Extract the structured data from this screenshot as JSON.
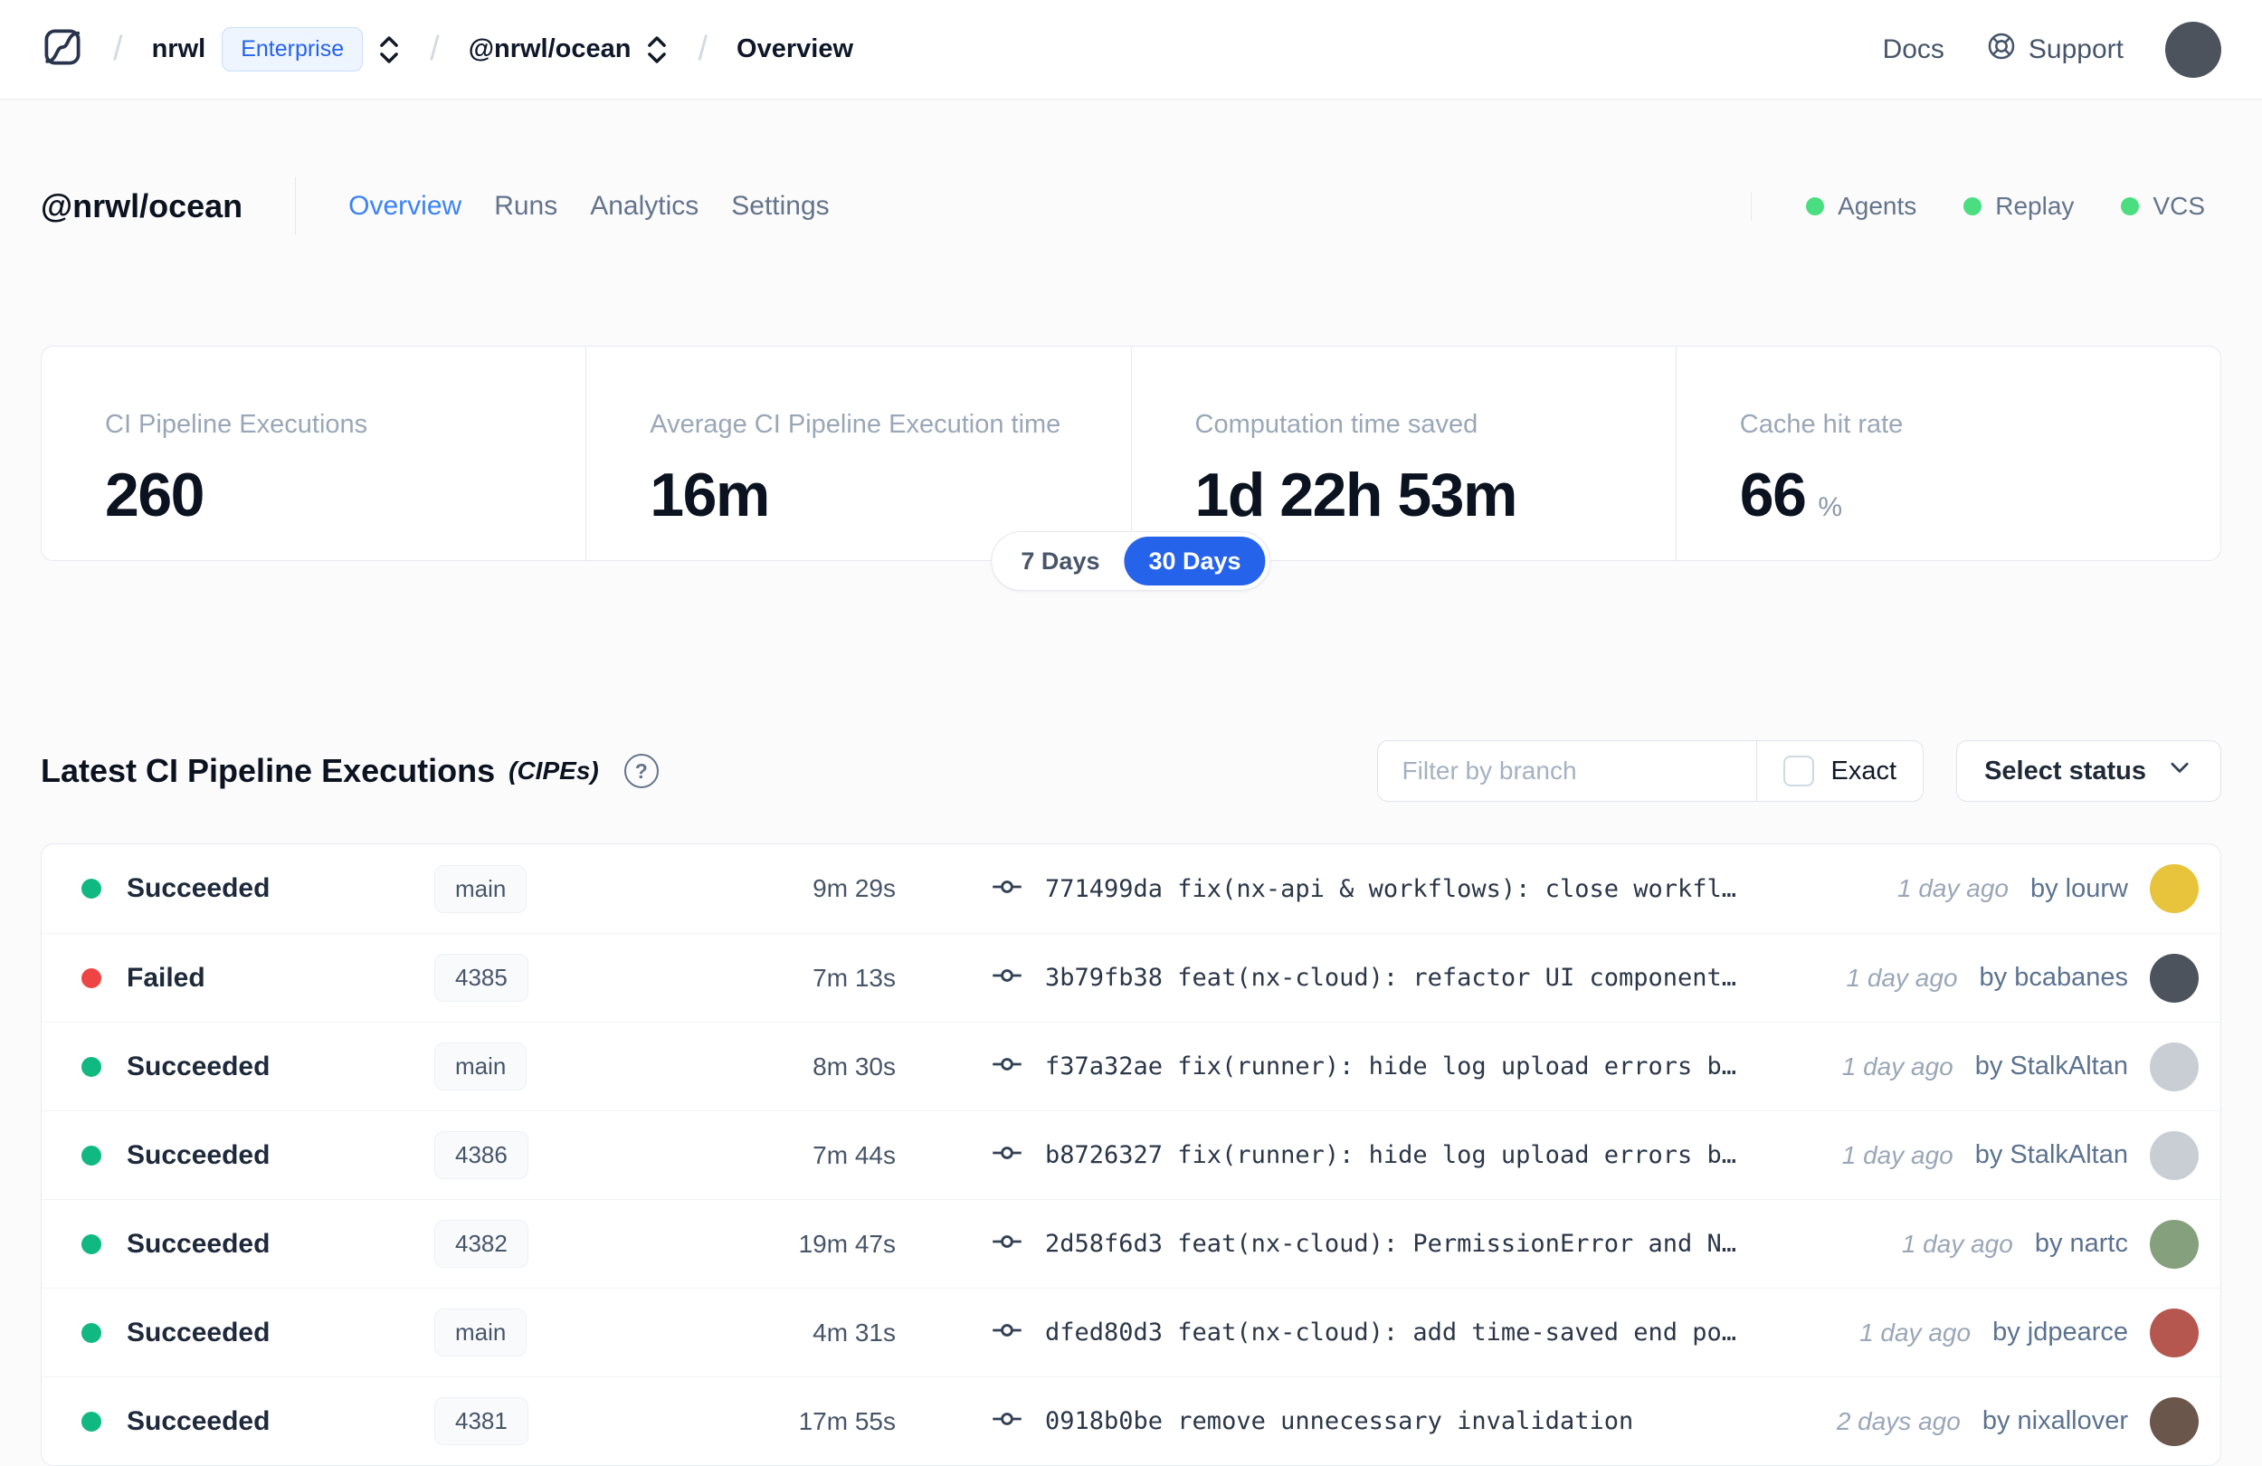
{
  "nav": {
    "breadcrumb": {
      "org": "nrwl",
      "org_badge": "Enterprise",
      "workspace": "@nrwl/ocean",
      "page": "Overview"
    },
    "docs_label": "Docs",
    "support_label": "Support",
    "avatar_color": "#4d535c"
  },
  "header": {
    "title": "@nrwl/ocean",
    "tabs": [
      {
        "label": "Overview",
        "active": true
      },
      {
        "label": "Runs",
        "active": false
      },
      {
        "label": "Analytics",
        "active": false
      },
      {
        "label": "Settings",
        "active": false
      }
    ],
    "features": [
      {
        "label": "Agents",
        "color": "#4ade80"
      },
      {
        "label": "Replay",
        "color": "#4ade80"
      },
      {
        "label": "VCS",
        "color": "#4ade80"
      }
    ]
  },
  "stats": {
    "cards": [
      {
        "label": "CI Pipeline Executions",
        "value": "260",
        "suffix": ""
      },
      {
        "label": "Average CI Pipeline Execution time",
        "value": "16m",
        "suffix": ""
      },
      {
        "label": "Computation time saved",
        "value": "1d 22h 53m",
        "suffix": ""
      },
      {
        "label": "Cache hit rate",
        "value": "66",
        "suffix": "%"
      }
    ],
    "range": {
      "options": [
        "7 Days",
        "30 Days"
      ],
      "selected": "30 Days"
    }
  },
  "cipes": {
    "title": "Latest CI Pipeline Executions",
    "title_suffix": "(CIPEs)",
    "help_glyph": "?",
    "filter": {
      "placeholder": "Filter by branch",
      "exact_label": "Exact",
      "exact_checked": false,
      "status_button": "Select status"
    },
    "rows": [
      {
        "status": "Succeeded",
        "status_color": "#10b981",
        "branch": "main",
        "duration": "9m 29s",
        "commit": "771499da fix(nx-api & workflows): close workfl…",
        "time_ago": "1 day ago",
        "author": "by lourw",
        "avatar_color": "#e8c33c"
      },
      {
        "status": "Failed",
        "status_color": "#ef4444",
        "branch": "4385",
        "duration": "7m 13s",
        "commit": "3b79fb38 feat(nx-cloud): refactor UI component…",
        "time_ago": "1 day ago",
        "author": "by bcabanes",
        "avatar_color": "#4d535c"
      },
      {
        "status": "Succeeded",
        "status_color": "#10b981",
        "branch": "main",
        "duration": "8m 30s",
        "commit": "f37a32ae fix(runner): hide log upload errors b…",
        "time_ago": "1 day ago",
        "author": "by StalkAltan",
        "avatar_color": "#c9ced4"
      },
      {
        "status": "Succeeded",
        "status_color": "#10b981",
        "branch": "4386",
        "duration": "7m 44s",
        "commit": "b8726327 fix(runner): hide log upload errors b…",
        "time_ago": "1 day ago",
        "author": "by StalkAltan",
        "avatar_color": "#c9ced4"
      },
      {
        "status": "Succeeded",
        "status_color": "#10b981",
        "branch": "4382",
        "duration": "19m 47s",
        "commit": "2d58f6d3 feat(nx-cloud): PermissionError and N…",
        "time_ago": "1 day ago",
        "author": "by nartc",
        "avatar_color": "#84a07c"
      },
      {
        "status": "Succeeded",
        "status_color": "#10b981",
        "branch": "main",
        "duration": "4m 31s",
        "commit": "dfed80d3 feat(nx-cloud): add time-saved end po…",
        "time_ago": "1 day ago",
        "author": "by jdpearce",
        "avatar_color": "#b5574f"
      },
      {
        "status": "Succeeded",
        "status_color": "#10b981",
        "branch": "4381",
        "duration": "17m 55s",
        "commit": "0918b0be remove unnecessary invalidation",
        "time_ago": "2 days ago",
        "author": "by nixallover",
        "avatar_color": "#6b564c"
      }
    ]
  },
  "colors": {
    "accent": "#2563eb",
    "tab_active": "#3b82f6",
    "succeeded": "#10b981",
    "failed": "#ef4444",
    "feature_ok": "#4ade80"
  }
}
